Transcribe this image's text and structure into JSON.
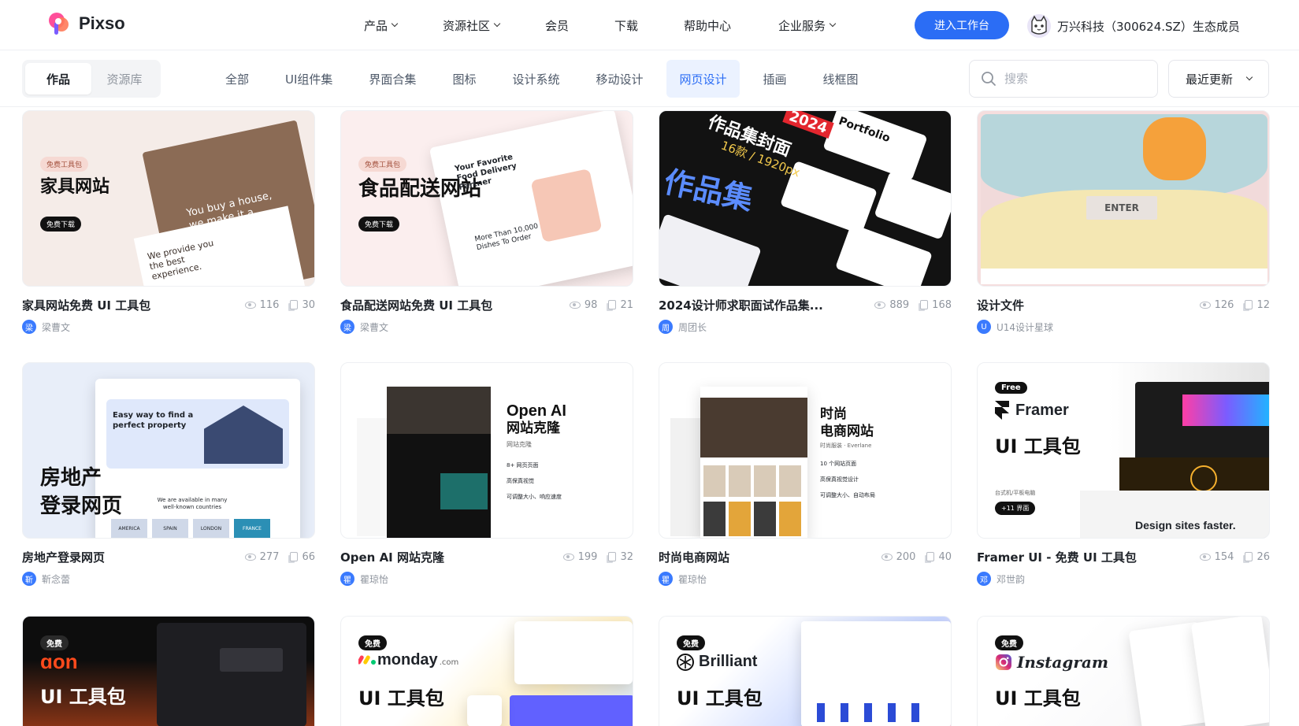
{
  "brand": {
    "name": "Pixso",
    "primary": "#2b6df5"
  },
  "nav": [
    {
      "label": "产品",
      "has_menu": true
    },
    {
      "label": "资源社区",
      "has_menu": true
    },
    {
      "label": "会员",
      "has_menu": false
    },
    {
      "label": "下载",
      "has_menu": false
    },
    {
      "label": "帮助中心",
      "has_menu": false
    },
    {
      "label": "企业服务",
      "has_menu": true
    }
  ],
  "cta_label": "进入工作台",
  "partner_label": "万兴科技（300624.SZ）生态成员",
  "segment": {
    "items": [
      "作品",
      "资源库"
    ],
    "active": "作品"
  },
  "categories": {
    "items": [
      "全部",
      "UI组件集",
      "界面合集",
      "图标",
      "设计系统",
      "移动设计",
      "网页设计",
      "插画",
      "线框图"
    ],
    "active": "网页设计"
  },
  "search": {
    "placeholder": "搜索",
    "value": ""
  },
  "sort": {
    "label": "最近更新"
  },
  "cards": [
    {
      "title": "家具网站免费 UI 工具包",
      "views": "116",
      "copies": "30",
      "author": "梁曹文",
      "avatar": "梁",
      "thumb": {
        "tag": "免费工具包",
        "headline": "家具网站",
        "button": "免费下载",
        "overlay": "You buy a house, we make it a home",
        "subtext": "We provide you the best experience."
      }
    },
    {
      "title": "食品配送网站免费 UI 工具包",
      "views": "98",
      "copies": "21",
      "author": "梁曹文",
      "avatar": "梁",
      "thumb": {
        "tag": "免费工具包",
        "headline": "食品配送网站",
        "button": "免费下载",
        "overlay": "Your Favorite Food Delivery Partner",
        "subtext": "More Than 10,000 Dishes To Order"
      }
    },
    {
      "title": "2024设计师求职面试作品集...",
      "views": "889",
      "copies": "168",
      "author": "周团长",
      "avatar": "周",
      "thumb": {
        "headline": "作品集封面",
        "year": "2024",
        "sub": "16款 / 1920px",
        "big": "作品集",
        "portfolio": "Portfolio"
      }
    },
    {
      "title": "设计文件",
      "views": "126",
      "copies": "12",
      "author": "U14设计星球",
      "avatar": "U",
      "thumb": {
        "button": "ENTER"
      }
    },
    {
      "title": "房地产登录网页",
      "views": "277",
      "copies": "66",
      "author": "靳念蕾",
      "avatar": "靳",
      "thumb": {
        "headline_line1": "房地产",
        "headline_line2": "登录网页",
        "hero": "Easy way to find a perfect property",
        "sub": "We are available in many well-known countries",
        "cities": [
          "AMERICA",
          "SPAIN",
          "LONDON",
          "FRANCE"
        ]
      }
    },
    {
      "title": "Open AI 网站克隆",
      "views": "199",
      "copies": "32",
      "author": "瞿琼怡",
      "avatar": "瞿",
      "thumb": {
        "headline_line1": "Open AI",
        "headline_line2": "网站克隆",
        "sub": "网站克隆",
        "points": [
          "8+ 网页页面",
          "高保真视觉",
          "可调整大小、响应速度"
        ]
      }
    },
    {
      "title": "时尚电商网站",
      "views": "200",
      "copies": "40",
      "author": "瞿琼怡",
      "avatar": "瞿",
      "thumb": {
        "headline_line1": "时尚",
        "headline_line2": "电商网站",
        "sub": "时尚服装 · Everlane",
        "points": [
          "10 个网站页面",
          "高保真视觉设计",
          "可调整大小、自动布局"
        ]
      }
    },
    {
      "title": "Framer UI - 免费 UI 工具包",
      "views": "154",
      "copies": "26",
      "author": "邓世韵",
      "avatar": "邓",
      "thumb": {
        "tag": "Free",
        "brand": "Framer",
        "headline": "UI 工具包",
        "sub": "台式机/平板电脑",
        "badge": "+11 界面",
        "footer": "Design sites faster."
      }
    },
    {
      "title": "",
      "views": "",
      "copies": "",
      "author": "",
      "avatar": "",
      "thumb": {
        "tag": "免费",
        "brand": "ɑon",
        "headline": "UI 工具包"
      }
    },
    {
      "title": "",
      "views": "",
      "copies": "",
      "author": "",
      "avatar": "",
      "thumb": {
        "tag": "免费",
        "brand": "monday",
        "brand_suffix": ".com",
        "headline": "UI 工具包"
      }
    },
    {
      "title": "",
      "views": "",
      "copies": "",
      "author": "",
      "avatar": "",
      "thumb": {
        "tag": "免费",
        "brand": "Brilliant",
        "headline": "UI 工具包"
      }
    },
    {
      "title": "",
      "views": "",
      "copies": "",
      "author": "",
      "avatar": "",
      "thumb": {
        "tag": "免费",
        "brand": "Instagram",
        "headline": "UI 工具包"
      }
    }
  ]
}
